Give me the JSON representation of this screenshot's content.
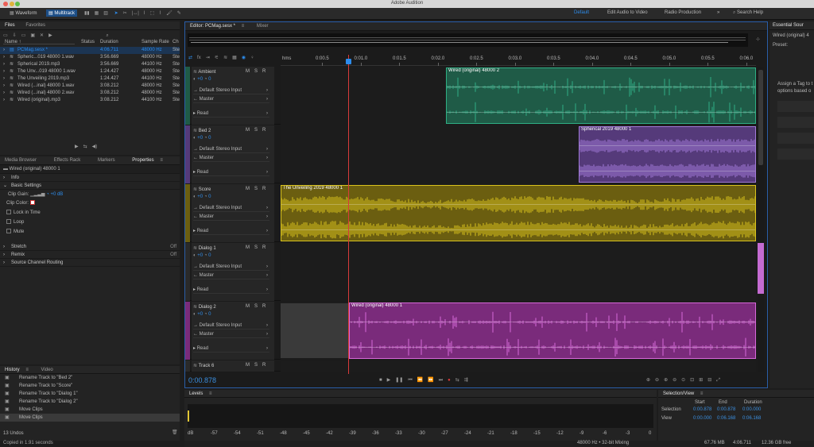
{
  "app_title": "Adobe Audition",
  "toolbar": {
    "waveform": "Waveform",
    "multitrack": "Multitrack"
  },
  "workspaces": {
    "default": "Default",
    "edit_video": "Edit Audio to Video",
    "radio": "Radio Production",
    "more": "»",
    "search": "Search Help"
  },
  "files_panel": {
    "tabs": [
      "Files",
      "Favorites"
    ],
    "columns": [
      "Name ↑",
      "Status",
      "Duration",
      "Sample Rate",
      "Ch"
    ],
    "files": [
      {
        "name": "PCMag.sesx *",
        "duration": "4:06.711",
        "rate": "48000 Hz",
        "ch": "Ste"
      },
      {
        "name": "Spheric...019 48000 1.wav",
        "duration": "3:56.669",
        "rate": "48000 Hz",
        "ch": "Ste"
      },
      {
        "name": "Spherical 2019.mp3",
        "duration": "3:56.669",
        "rate": "44100 Hz",
        "ch": "Ste"
      },
      {
        "name": "The Unv...019 48000 1.wav",
        "duration": "1:24.427",
        "rate": "48000 Hz",
        "ch": "Ste"
      },
      {
        "name": "The Unveiling 2019.mp3",
        "duration": "1:24.427",
        "rate": "44100 Hz",
        "ch": "Ste"
      },
      {
        "name": "Wired (...inal) 48000 1.wav",
        "duration": "3:08.212",
        "rate": "48000 Hz",
        "ch": "Ste"
      },
      {
        "name": "Wired (...inal) 48000 2.wav",
        "duration": "3:08.212",
        "rate": "48000 Hz",
        "ch": "Ste"
      },
      {
        "name": "Wired (original).mp3",
        "duration": "3:08.212",
        "rate": "44100 Hz",
        "ch": "Ste"
      }
    ]
  },
  "props_panel": {
    "tabs": [
      "Media Browser",
      "Effects Rack",
      "Markers",
      "Properties"
    ],
    "clip_name": "Wired (original) 48000 1",
    "info": "Info",
    "basic": "Basic Settings",
    "clip_gain_label": "Clip Gain:",
    "clip_gain_value": "+0 dB",
    "clip_color_label": "Clip Color:",
    "checks": [
      "Lock in Time",
      "Loop",
      "Mute"
    ],
    "stretch": "Stretch",
    "stretch_val": "Off",
    "remix": "Remix",
    "remix_val": "Off",
    "source_routing": "Source Channel Routing"
  },
  "history_panel": {
    "tabs": [
      "History",
      "Video"
    ],
    "items": [
      "Rename Track to \"Bed 2\"",
      "Rename Track to \"Score\"",
      "Rename Track to \"Dialog 1\"",
      "Rename Track to \"Dialog 2\"",
      "Move Clips",
      "Move Clips"
    ],
    "undos": "13 Undos"
  },
  "status_left": "Copied in 1.91 seconds",
  "editor": {
    "tab": "Editor: PCMag.sesx *",
    "tab2": "Mixer",
    "ruler_unit": "hms",
    "ruler": [
      "0:00.5",
      "0:01.0",
      "0:01.5",
      "0:02.0",
      "0:02.5",
      "0:03.0",
      "0:03.5",
      "0:04.0",
      "0:04.5",
      "0:05.0",
      "0:05.5",
      "0:06.0"
    ],
    "time": "0:00.878"
  },
  "tracks": [
    {
      "name": "Ambient",
      "vol": "+0",
      "pan": "0",
      "input": "Default Stereo Input",
      "output": "Master",
      "mode": "Read",
      "clip": "Wired (original) 48000 2",
      "color": "#2fae84",
      "bg": "#1f5b47"
    },
    {
      "name": "Bed 2",
      "vol": "+0",
      "pan": "0",
      "input": "Default Stereo Input",
      "output": "Master",
      "mode": "Read",
      "clip": "Spherical 2019 48000 1",
      "color": "#a27ad9",
      "bg": "#553a7a"
    },
    {
      "name": "Score",
      "vol": "+0",
      "pan": "0",
      "input": "Default Stereo Input",
      "output": "Master",
      "mode": "Read",
      "clip": "The Unveiling 2019 48000 1",
      "color": "#d8c21d",
      "bg": "#6b5e10"
    },
    {
      "name": "Dialog 1",
      "vol": "+0",
      "pan": "0",
      "input": "Default Stereo Input",
      "output": "Master",
      "mode": "Read",
      "clip": "",
      "color": "#888888",
      "bg": "#2a2a2a"
    },
    {
      "name": "Dialog 2",
      "vol": "+0",
      "pan": "0",
      "input": "Default Stereo Input",
      "output": "Master",
      "mode": "Read",
      "clip": "Wired (original) 48000 1",
      "color": "#d768d8",
      "bg": "#7a2b7b"
    },
    {
      "name": "Track 6",
      "vol": "",
      "pan": "",
      "input": "",
      "output": "",
      "mode": "",
      "clip": "",
      "color": "#888888",
      "bg": "#2a2a2a"
    }
  ],
  "levels": {
    "title": "Levels",
    "scale": [
      "dB",
      "-57",
      "-54",
      "-51",
      "-48",
      "-45",
      "-42",
      "-39",
      "-36",
      "-33",
      "-30",
      "-27",
      "-24",
      "-21",
      "-18",
      "-15",
      "-12",
      "-9",
      "-6",
      "-3",
      "0"
    ]
  },
  "selection": {
    "title": "Selection/View",
    "cols": [
      "Start",
      "End",
      "Duration"
    ],
    "rows": [
      {
        "label": "Selection",
        "start": "0:00.878",
        "end": "0:00.878",
        "dur": "0:00.000"
      },
      {
        "label": "View",
        "start": "0:00.000",
        "end": "0:06.168",
        "dur": "0:06.168"
      }
    ]
  },
  "status_right": {
    "rate": "48000 Hz • 32-bit Mixing",
    "mb": "67.76 MB",
    "dur": "4:06.711",
    "free": "12.36 GB free"
  },
  "essential": {
    "title": "Essential Sour",
    "clip": "Wired (original) 4",
    "preset": "Preset:",
    "hint1": "Assign a Tag to t",
    "hint2": "options based o"
  }
}
